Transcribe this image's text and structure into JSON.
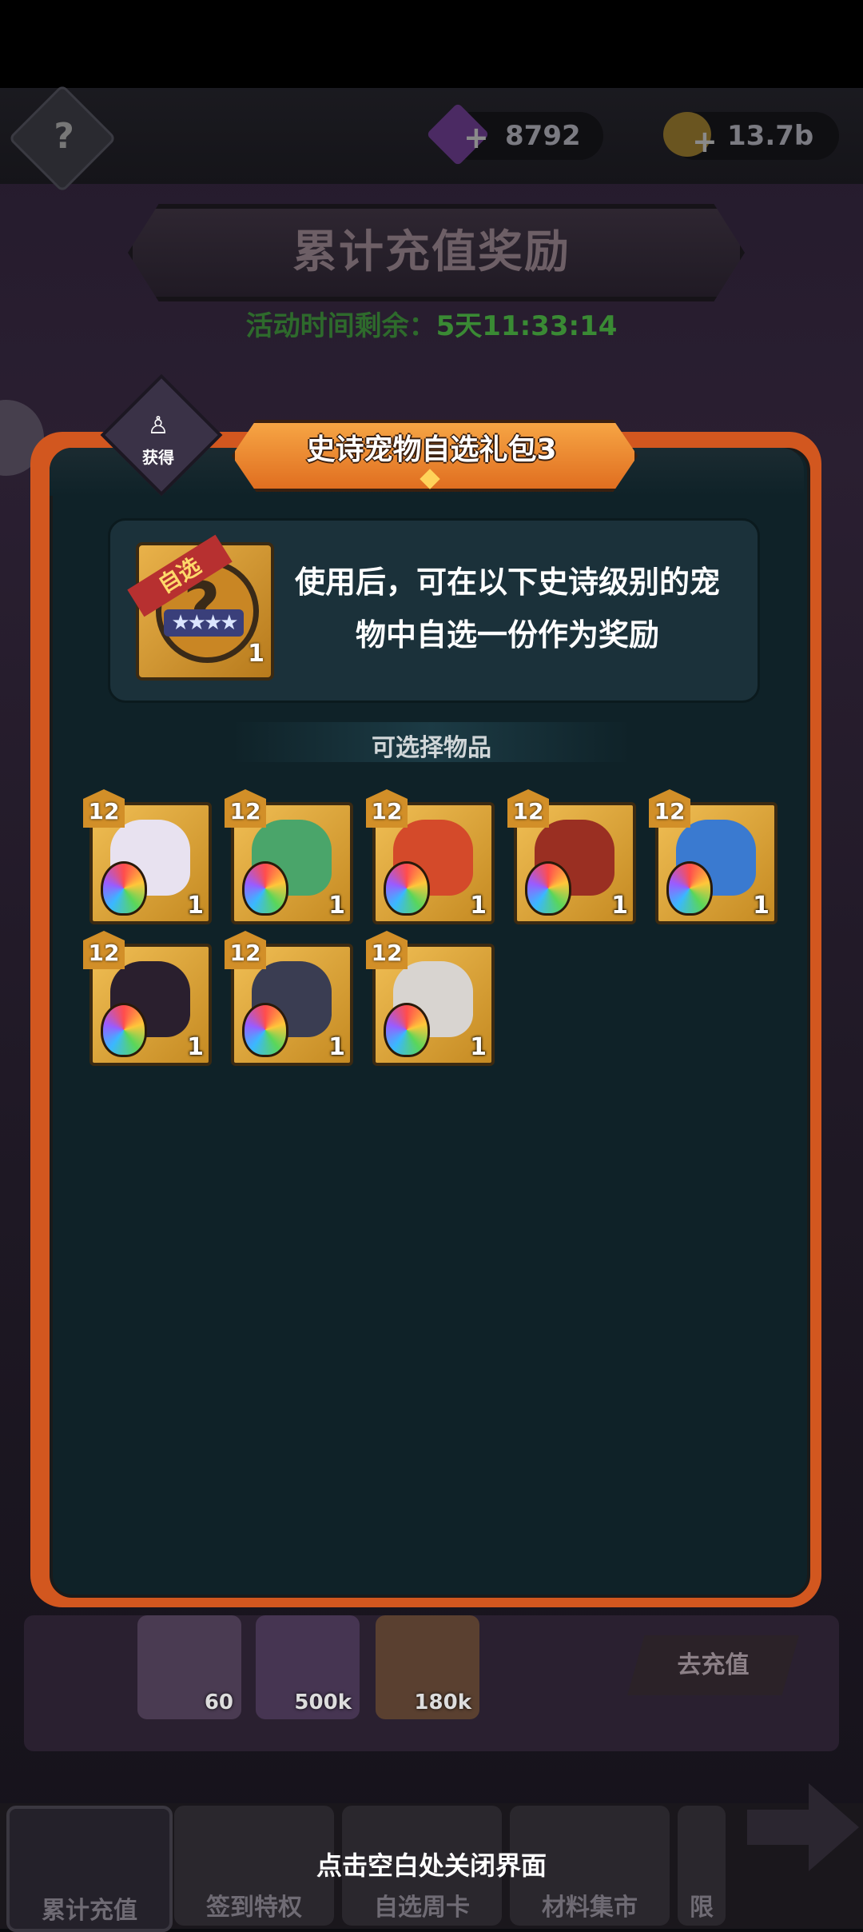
{
  "header": {
    "gems": "8792",
    "gold": "13.7b",
    "help_icon": "?"
  },
  "event": {
    "title": "累计充值奖励",
    "timer_label": "活动时间剩余：",
    "timer_value": "5天11:33:14"
  },
  "modal": {
    "obtained_label": "获得",
    "title": "史诗宠物自选礼包3",
    "pack": {
      "tag": "自选",
      "stars": "★★★★",
      "count": "1"
    },
    "description": "使用后，可在以下史诗级别的宠物中自选一份作为奖励",
    "section_title": "可选择物品",
    "pets": [
      {
        "level": "12",
        "count": "1",
        "color": "#e8e2f0"
      },
      {
        "level": "12",
        "count": "1",
        "color": "#4aa56a"
      },
      {
        "level": "12",
        "count": "1",
        "color": "#d44a2a"
      },
      {
        "level": "12",
        "count": "1",
        "color": "#9a2f22"
      },
      {
        "level": "12",
        "count": "1",
        "color": "#3a7ad0"
      },
      {
        "level": "12",
        "count": "1",
        "color": "#2a1f2e"
      },
      {
        "level": "12",
        "count": "1",
        "color": "#3a3d52"
      },
      {
        "level": "12",
        "count": "1",
        "color": "#d8d4d0"
      }
    ]
  },
  "background": {
    "reward_counts": [
      "60",
      "500k",
      "180k"
    ],
    "recharge_button": "去充值"
  },
  "tabs": [
    "累计充值",
    "签到特权",
    "自选周卡",
    "材料集市",
    "限"
  ],
  "close_hint": "点击空白处关闭界面"
}
